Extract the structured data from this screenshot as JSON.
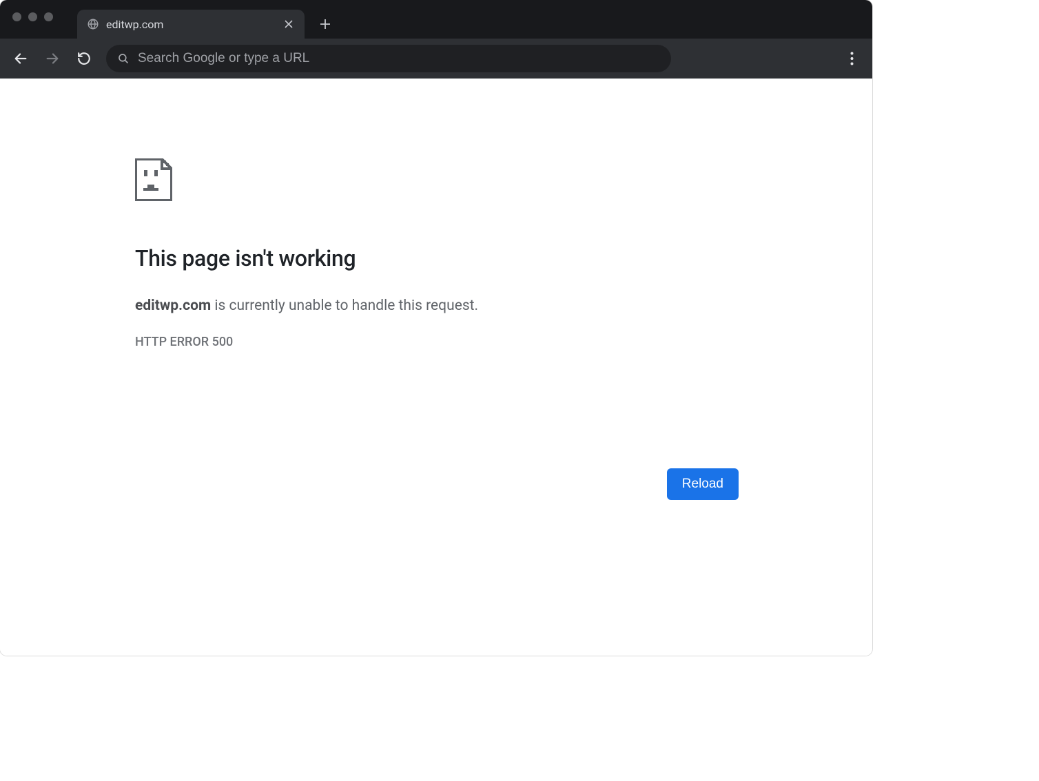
{
  "tab": {
    "title": "editwp.com"
  },
  "omnibox": {
    "placeholder": "Search Google or type a URL",
    "value": ""
  },
  "error": {
    "title": "This page isn't working",
    "host": "editwp.com",
    "message_tail": " is currently unable to handle this request.",
    "code": "HTTP ERROR 500",
    "reload_label": "Reload"
  }
}
